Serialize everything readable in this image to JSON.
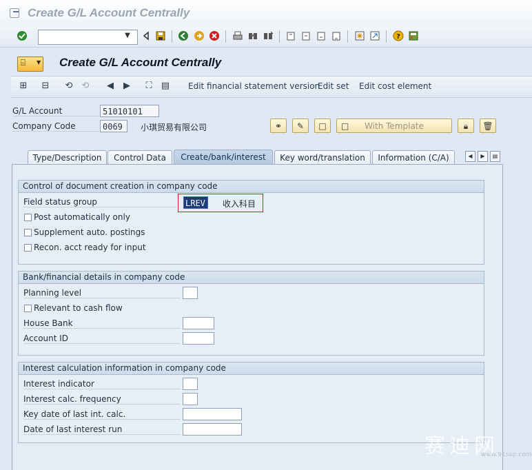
{
  "window": {
    "title": "Create G/L Account Centrally"
  },
  "std_toolbar": {
    "command_field_value": "",
    "icons": [
      "enter-icon",
      "save-icon",
      "back-icon",
      "exit-icon",
      "cancel-icon",
      "print-icon",
      "find-icon",
      "find-next-icon",
      "first-page-icon",
      "previous-page-icon",
      "next-page-icon",
      "last-page-icon",
      "new-session-icon",
      "shortcut-icon",
      "help-icon",
      "layout-icon"
    ]
  },
  "screen": {
    "title": "Create G/L Account Centrally"
  },
  "app_toolbar": {
    "edit_fs_version": "Edit financial statement version",
    "edit_set": "Edit set",
    "edit_cost_element": "Edit cost element"
  },
  "header_fields": {
    "gl_account_label": "G/L Account",
    "gl_account_value": "51010101",
    "company_code_label": "Company Code",
    "company_code_value": "0069",
    "company_name": "小琪贸易有限公司",
    "with_template": "With Template"
  },
  "tabs": [
    {
      "label": "Type/Description",
      "active": false
    },
    {
      "label": "Control Data",
      "active": false
    },
    {
      "label": "Create/bank/interest",
      "active": true
    },
    {
      "label": "Key word/translation",
      "active": false
    },
    {
      "label": "Information (C/A)",
      "active": false
    }
  ],
  "group_doc_creation": {
    "title": "Control of document creation in company code",
    "field_status_group_label": "Field status group",
    "field_status_group_value": "LREV",
    "field_status_group_text": "收入科目",
    "post_auto_label": "Post automatically only",
    "post_auto_checked": false,
    "supplement_label": "Supplement auto. postings",
    "supplement_checked": false,
    "recon_label": "Recon. acct ready for input",
    "recon_checked": false
  },
  "group_bank": {
    "title": "Bank/financial details in company code",
    "planning_level_label": "Planning level",
    "planning_level_value": "",
    "cash_flow_label": "Relevant to cash flow",
    "cash_flow_checked": false,
    "house_bank_label": "House Bank",
    "house_bank_value": "",
    "account_id_label": "Account ID",
    "account_id_value": ""
  },
  "group_interest": {
    "title": "Interest calculation information in company code",
    "indicator_label": "Interest indicator",
    "indicator_value": "",
    "frequency_label": "Interest calc. frequency",
    "frequency_value": "",
    "key_date_label": "Key date of last int. calc.",
    "key_date_value": "",
    "last_run_label": "Date of last interest run",
    "last_run_value": ""
  },
  "watermark": {
    "text": "赛迪网",
    "url": "www.91sap.com"
  }
}
